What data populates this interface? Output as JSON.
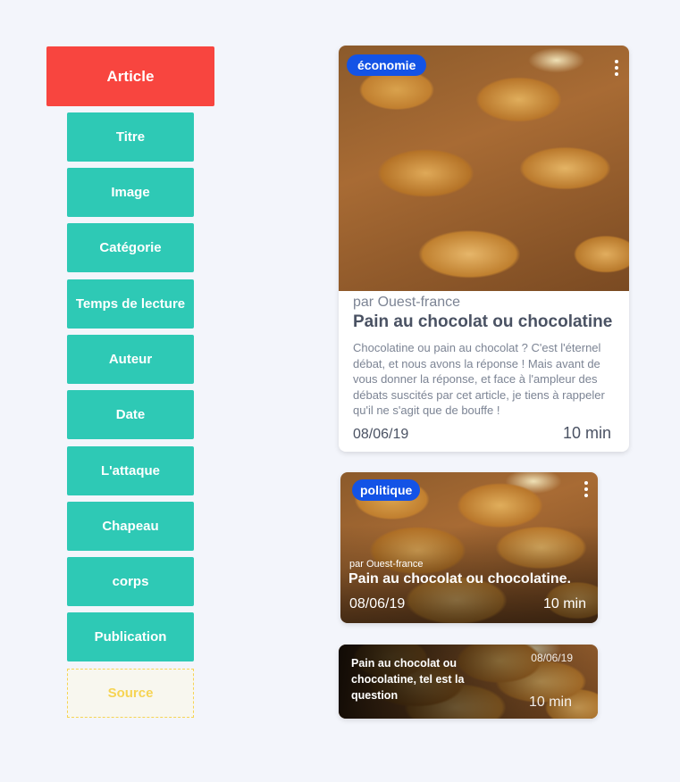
{
  "structure": {
    "root": "Article",
    "fields": [
      "Titre",
      "Image",
      "Catégorie",
      "Temps de lecture",
      "Auteur",
      "Date",
      "L'attaque",
      "Chapeau",
      "corps",
      "Publication"
    ],
    "optional": "Source"
  },
  "cards": {
    "large": {
      "category": "économie",
      "source": "par Ouest-france",
      "title": "Pain au chocolat ou chocolatine",
      "description": "Chocolatine ou pain au chocolat ? C'est l'éternel débat, et nous avons la réponse ! Mais avant de vous donner la réponse, et face à l'ampleur des débats suscités par cet article, je tiens à rappeler qu'il ne s'agit que de bouffe !",
      "date": "08/06/19",
      "reading_time": "10 min"
    },
    "medium": {
      "category": "politique",
      "source": "par Ouest-france",
      "title": "Pain au chocolat ou chocolatine.",
      "date": "08/06/19",
      "reading_time": "10 min"
    },
    "small": {
      "title": "Pain au chocolat ou chocolatine, tel est la question",
      "date": "08/06/19",
      "reading_time": "10 min"
    }
  },
  "colors": {
    "article": "#f8453f",
    "field": "#2ec9b5",
    "source_border": "#f6d454",
    "badge": "#1353e6"
  }
}
